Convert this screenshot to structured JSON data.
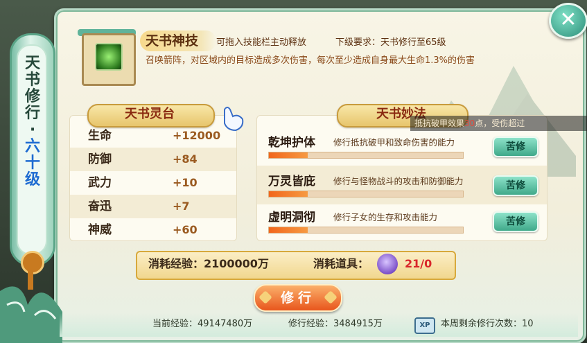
{
  "window": {
    "close_label": "✕"
  },
  "scroll": {
    "line1": "天书修行·",
    "line2": "六十级"
  },
  "skill": {
    "title": "天书神技",
    "hint": "可拖入技能栏主动释放",
    "requirement": "下级要求：天书修行至65级",
    "description": "召唤箭阵，对区域内的目标造成多次伤害，每次至少造成自身最大生命1.3%的伤害",
    "icon": "green-arrow-skill-icon"
  },
  "stats_section": {
    "title": "天书灵台",
    "rows": [
      {
        "name": "生命",
        "value": "+12000"
      },
      {
        "name": "防御",
        "value": "+84"
      },
      {
        "name": "武力",
        "value": "+10"
      },
      {
        "name": "奋迅",
        "value": "+7"
      },
      {
        "name": "神威",
        "value": "+60"
      }
    ]
  },
  "arts_section": {
    "title": "天书妙法",
    "rows": [
      {
        "name": "乾坤护体",
        "desc": "修行抵抗破甲和致命伤害的能力",
        "progress": 0.2,
        "button": "苦修"
      },
      {
        "name": "万灵皆庇",
        "desc": "修行与怪物战斗的攻击和防御能力",
        "progress": 0.2,
        "button": "苦修"
      },
      {
        "name": "虚明洞彻",
        "desc": "修行子女的生存和攻击能力",
        "progress": 0.2,
        "button": "苦修"
      }
    ]
  },
  "tooltip": {
    "prefix": "抵抗破甲效果",
    "value": "30",
    "suffix": "点，受伤超过"
  },
  "cost": {
    "exp_label": "消耗经验：2100000万",
    "item_label": "消耗道具：",
    "item_count": "21/0",
    "item_icon": "purple-spirit-orb-icon"
  },
  "train_button": "修行",
  "footer": {
    "current_exp": "当前经验：49147480万",
    "train_exp": "修行经验：3484915万",
    "weekly_remaining": "本周剩余修行次数：10",
    "xp_icon": "XP"
  },
  "colors": {
    "accent_orange": "#f2661b",
    "accent_teal": "#3fa98a",
    "title_brown": "#8a2a10",
    "count_red": "#d9252a"
  }
}
